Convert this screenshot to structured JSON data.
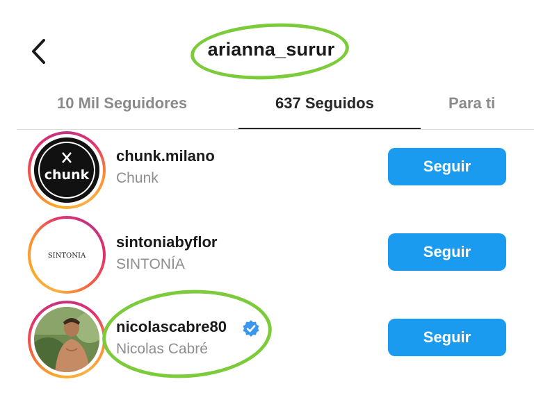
{
  "header": {
    "title": "arianna_surur",
    "back_icon": "chevron-left-icon"
  },
  "tabs": [
    {
      "label": "10 Mil Seguidores",
      "active": false
    },
    {
      "label": "637 Seguidos",
      "active": true
    },
    {
      "label": "Para ti",
      "active": false
    }
  ],
  "accounts": [
    {
      "username": "chunk.milano",
      "fullname": "Chunk",
      "avatar_text": "chunk",
      "verified": false,
      "button_label": "Seguir"
    },
    {
      "username": "sintoniabyflor",
      "fullname": "SINTONÍA",
      "avatar_text": "SINTONIA",
      "verified": false,
      "button_label": "Seguir"
    },
    {
      "username": "nicolascabre80",
      "fullname": "Nicolas Cabré",
      "avatar_text": "",
      "verified": true,
      "button_label": "Seguir"
    }
  ],
  "colors": {
    "accent": "#1a9bf0",
    "highlight_oval": "#7ccb3b",
    "verified_badge": "#3897f0"
  }
}
